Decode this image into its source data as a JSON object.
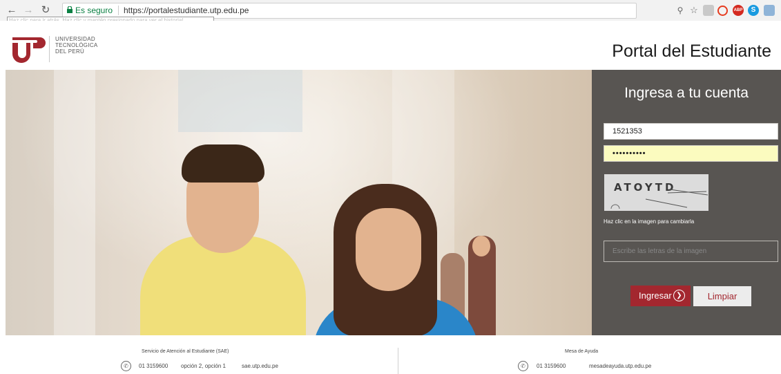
{
  "browser": {
    "secure_label": "Es seguro",
    "url": "https://portalestudiante.utp.edu.pe",
    "tooltip": "Haz clic para ir atrás. Haz clic y mantén presionado para ver el historial"
  },
  "header": {
    "logo_line1": "UNIVERSIDAD",
    "logo_line2": "TECNOLÓGICA",
    "logo_line3": "DEL PERÚ",
    "title": "Portal del Estudiante"
  },
  "login": {
    "title": "Ingresa a tu cuenta",
    "username_value": "1521353",
    "password_value": "••••••••••",
    "captcha_text": "ATOYTD",
    "captcha_hint": "Haz clic en la imagen para cambiarla",
    "captcha_placeholder": "Escribe las letras de la imagen",
    "submit_label": "Ingresar",
    "clear_label": "Limpiar"
  },
  "footer": {
    "left": {
      "title": "Servicio de Atención al Estudiante (SAE)",
      "phone": "01 3159600",
      "options": "opción 2,  opción 1",
      "site": "sae.utp.edu.pe"
    },
    "right": {
      "title": "Mesa de Ayuda",
      "phone": "01 3159600",
      "site": "mesadeayuda.utp.edu.pe"
    }
  },
  "colors": {
    "brand": "#a3272f",
    "panel": "#585552",
    "password_fill": "#fbfbbf"
  }
}
